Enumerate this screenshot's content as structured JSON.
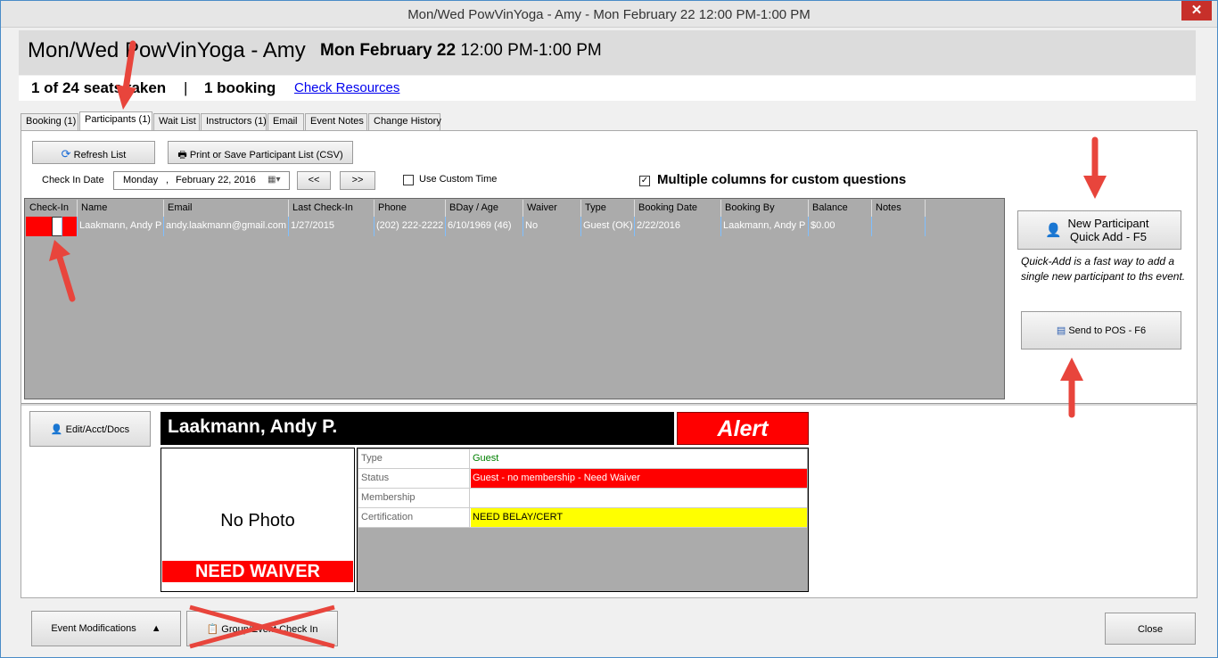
{
  "window": {
    "title": "Mon/Wed PowVinYoga - Amy - Mon February 22 12:00 PM-1:00 PM",
    "close_label": "✕"
  },
  "header": {
    "event_name": "Mon/Wed PowVinYoga - Amy",
    "event_day": "Mon February 22",
    "event_time": "12:00 PM-1:00 PM"
  },
  "info": {
    "seats": "1 of 24 seats taken",
    "separator": "|",
    "bookings": "1 booking",
    "check_resources": "Check Resources"
  },
  "tabs": [
    {
      "label": "Booking (1)"
    },
    {
      "label": "Participants (1)",
      "active": true
    },
    {
      "label": "Wait List"
    },
    {
      "label": "Instructors (1)"
    },
    {
      "label": "Email"
    },
    {
      "label": "Event Notes"
    },
    {
      "label": "Change History"
    }
  ],
  "toolbar": {
    "refresh": "Refresh List",
    "print": "Print or Save Participant List (CSV)",
    "checkin_date_label": "Check In Date",
    "date_weekday": "Monday",
    "date_sep": ",",
    "date_value": "February  22, 2016",
    "prev": "<<",
    "next": ">>",
    "custom_time": "Use Custom Time",
    "custom_time_checked": false,
    "multi_columns": "Multiple columns for custom questions",
    "multi_columns_checked": true
  },
  "grid": {
    "columns": [
      "Check-In",
      "Name",
      "Email",
      "Last Check-In",
      "Phone",
      "BDay / Age",
      "Waiver",
      "Type",
      "Booking Date",
      "Booking By",
      "Balance",
      "Notes"
    ],
    "rows": [
      {
        "checked": true,
        "name": "Laakmann, Andy P",
        "email": "andy.laakmann@gmail.com",
        "last_checkin": "1/27/2015",
        "phone": "(202) 222-2222",
        "bday": "6/10/1969 (46)",
        "waiver": "No",
        "type": "Guest (OK)",
        "booking_date": "2/22/2016",
        "booking_by": "Laakmann, Andy P",
        "balance": "$0.00",
        "notes": ""
      }
    ]
  },
  "side": {
    "new_participant_line1": "New Participant",
    "new_participant_line2": "Quick Add  - F5",
    "quick_add_help": "Quick-Add is a fast way to add a single new participant to ths event.",
    "send_pos": "Send to POS - F6"
  },
  "detail": {
    "edit_button": "Edit/Acct/Docs",
    "name": "Laakmann, Andy P.",
    "alert": "Alert",
    "no_photo": "No Photo",
    "need_waiver": "NEED WAIVER",
    "fields": [
      {
        "label": "Type",
        "value": "Guest",
        "bg": "#ffffff",
        "color": "#008000"
      },
      {
        "label": "Status",
        "value": "Guest - no membership - Need Waiver",
        "bg": "#ff0000",
        "color": "#ffffff"
      },
      {
        "label": "Membership",
        "value": "",
        "bg": "#ffffff",
        "color": "#000000"
      },
      {
        "label": "Certification",
        "value": "NEED BELAY/CERT",
        "bg": "#ffff00",
        "color": "#000000"
      }
    ]
  },
  "footer": {
    "event_mods": "Event Modifications",
    "group_checkin": "Group/Event Check In",
    "close": "Close"
  },
  "colors": {
    "selection": "#3399ff",
    "alert": "#ff0000",
    "annotation_arrow": "#e8453c"
  }
}
